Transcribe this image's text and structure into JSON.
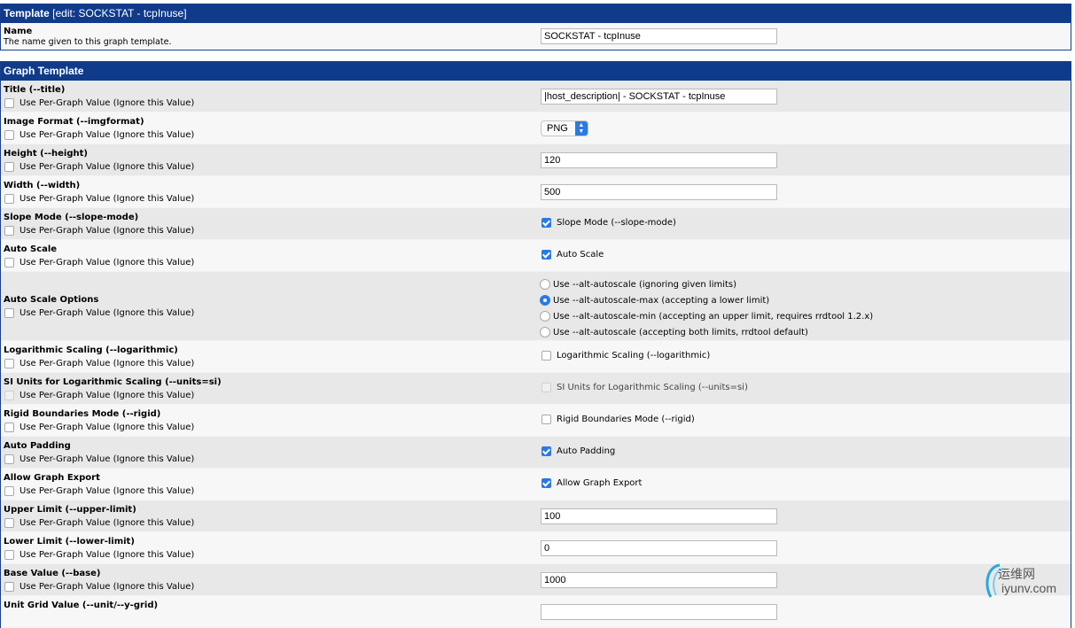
{
  "template_section": {
    "title": "Template",
    "subtitle": "[edit: SOCKSTAT - tcpInuse]",
    "name_label": "Name",
    "name_desc": "The name given to this graph template.",
    "name_value": "SOCKSTAT - tcpInuse"
  },
  "graph_section": {
    "title": "Graph Template"
  },
  "per_graph_label": "Use Per-Graph Value (Ignore this Value)",
  "fields": {
    "title": {
      "label": "Title (--title)",
      "value": "|host_description| - SOCKSTAT - tcpInuse"
    },
    "imgformat": {
      "label": "Image Format (--imgformat)",
      "value": "PNG"
    },
    "height": {
      "label": "Height (--height)",
      "value": "120"
    },
    "width": {
      "label": "Width (--width)",
      "value": "500"
    },
    "slope": {
      "label": "Slope Mode (--slope-mode)",
      "check_label": "Slope Mode (--slope-mode)"
    },
    "autoscale": {
      "label": "Auto Scale",
      "check_label": "Auto Scale"
    },
    "autoscale_opts": {
      "label": "Auto Scale Options",
      "options": [
        "Use --alt-autoscale (ignoring given limits)",
        "Use --alt-autoscale-max (accepting a lower limit)",
        "Use --alt-autoscale-min (accepting an upper limit, requires rrdtool 1.2.x)",
        "Use --alt-autoscale (accepting both limits, rrdtool default)"
      ]
    },
    "log": {
      "label": "Logarithmic Scaling (--logarithmic)",
      "check_label": "Logarithmic Scaling (--logarithmic)"
    },
    "si": {
      "label": "SI Units for Logarithmic Scaling (--units=si)",
      "check_label": "SI Units for Logarithmic Scaling (--units=si)"
    },
    "rigid": {
      "label": "Rigid Boundaries Mode (--rigid)",
      "check_label": "Rigid Boundaries Mode (--rigid)"
    },
    "padding": {
      "label": "Auto Padding",
      "check_label": "Auto Padding"
    },
    "export": {
      "label": "Allow Graph Export",
      "check_label": "Allow Graph Export"
    },
    "upper": {
      "label": "Upper Limit (--upper-limit)",
      "value": "100"
    },
    "lower": {
      "label": "Lower Limit (--lower-limit)",
      "value": "0"
    },
    "base": {
      "label": "Base Value (--base)",
      "value": "1000"
    },
    "unit_grid": {
      "label": "Unit Grid Value (--unit/--y-grid)"
    }
  },
  "watermark": {
    "cn": "运维网",
    "en": "iyunv.com"
  },
  "colors": {
    "header_bg": "#0f3b8a",
    "check_on": "#2a7ae2"
  }
}
